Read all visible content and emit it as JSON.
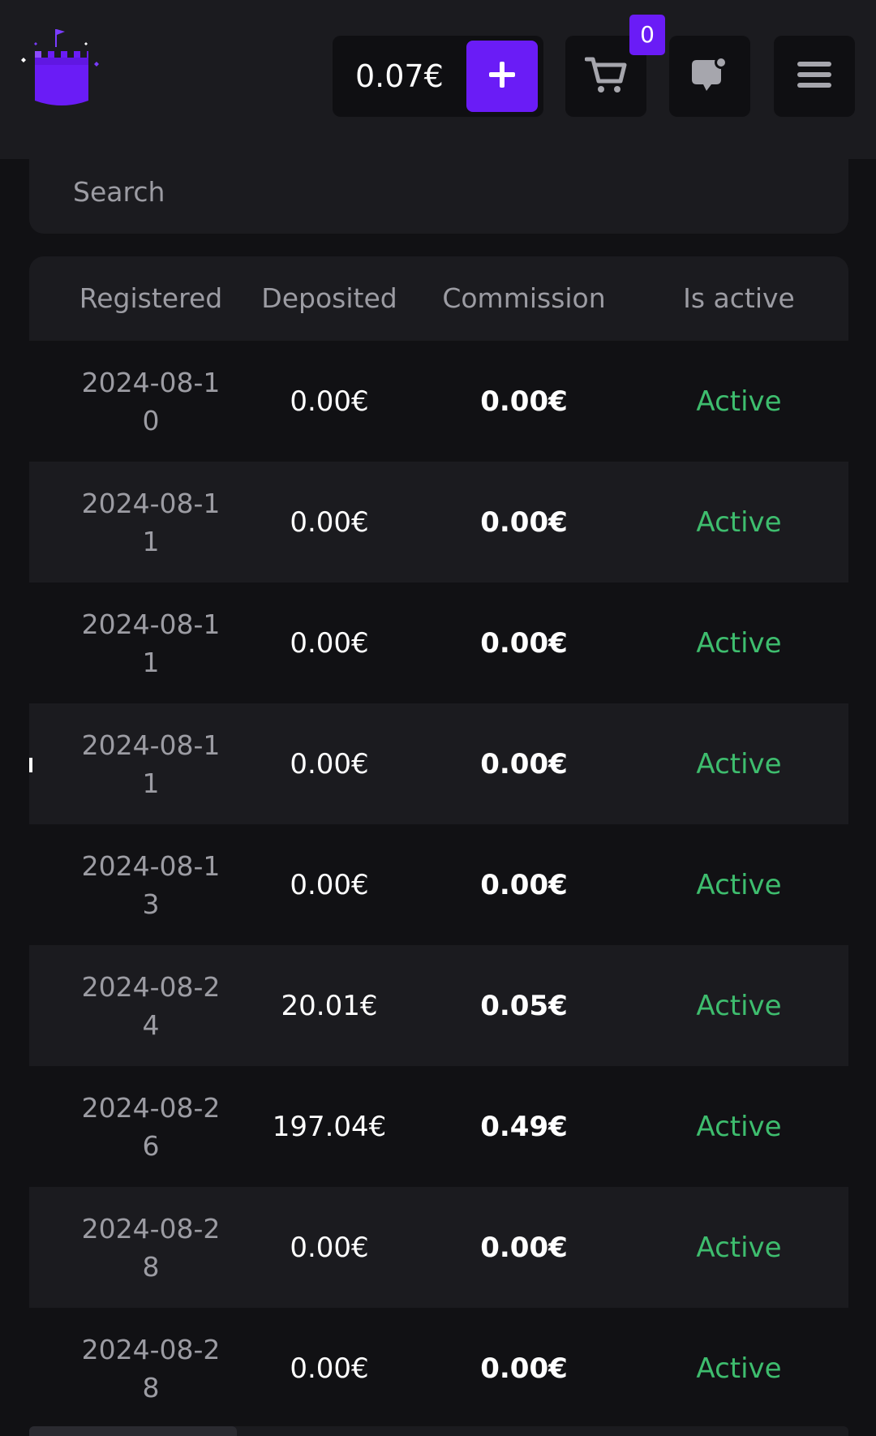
{
  "header": {
    "balance": "0.07€",
    "add_funds_icon": "plus-icon",
    "cart_icon": "cart-icon",
    "cart_count": "0",
    "chat_icon": "chat-notification-icon",
    "menu_icon": "hamburger-menu-icon",
    "logo_icon": "castle-logo-icon"
  },
  "search": {
    "placeholder": "Search",
    "value": ""
  },
  "table": {
    "columns": [
      "Registered",
      "Deposited",
      "Commission",
      "Is active"
    ],
    "rows": [
      {
        "registered": "2024-08-10",
        "deposited": "0.00€",
        "commission": "0.00€",
        "status": "Active"
      },
      {
        "registered": "2024-08-11",
        "deposited": "0.00€",
        "commission": "0.00€",
        "status": "Active"
      },
      {
        "registered": "2024-08-11",
        "deposited": "0.00€",
        "commission": "0.00€",
        "status": "Active"
      },
      {
        "registered": "2024-08-11",
        "deposited": "0.00€",
        "commission": "0.00€",
        "status": "Active"
      },
      {
        "registered": "2024-08-13",
        "deposited": "0.00€",
        "commission": "0.00€",
        "status": "Active"
      },
      {
        "registered": "2024-08-24",
        "deposited": "20.01€",
        "commission": "0.05€",
        "status": "Active"
      },
      {
        "registered": "2024-08-26",
        "deposited": "197.04€",
        "commission": "0.49€",
        "status": "Active"
      },
      {
        "registered": "2024-08-28",
        "deposited": "0.00€",
        "commission": "0.00€",
        "status": "Active"
      },
      {
        "registered": "2024-08-28",
        "deposited": "0.00€",
        "commission": "0.00€",
        "status": "Active"
      }
    ]
  },
  "colors": {
    "accent": "#6a1cf6",
    "active_status": "#3ebd6e",
    "background": "#111114",
    "panel": "#1b1b1f",
    "muted_text": "#9c9ca3"
  }
}
